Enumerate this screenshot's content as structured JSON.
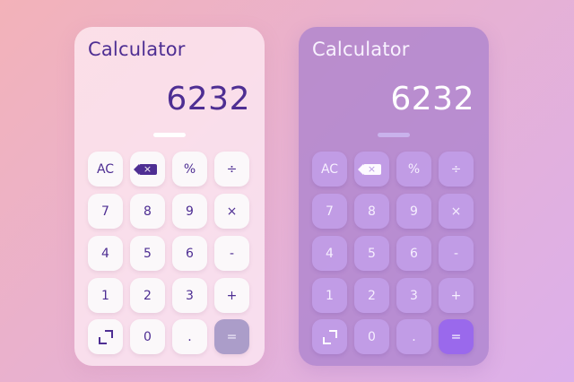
{
  "light": {
    "title": "Calculator",
    "display": "6232",
    "keys": {
      "ac": "AC",
      "percent": "%",
      "divide": "÷",
      "seven": "7",
      "eight": "8",
      "nine": "9",
      "multiply": "×",
      "four": "4",
      "five": "5",
      "six": "6",
      "minus": "-",
      "one": "1",
      "two": "2",
      "three": "3",
      "plus": "+",
      "zero": "0",
      "dot": ".",
      "equals": "="
    },
    "icons": {
      "backspace": "backspace-icon",
      "expand": "expand-icon"
    },
    "colors": {
      "text": "#4e2e93",
      "key": "#fbf8fa",
      "equals": "#ab9dc9"
    }
  },
  "dark": {
    "title": "Calculator",
    "display": "6232",
    "keys": {
      "ac": "AC",
      "percent": "%",
      "divide": "÷",
      "seven": "7",
      "eight": "8",
      "nine": "9",
      "multiply": "×",
      "four": "4",
      "five": "5",
      "six": "6",
      "minus": "-",
      "one": "1",
      "two": "2",
      "three": "3",
      "plus": "+",
      "zero": "0",
      "dot": ".",
      "equals": "="
    },
    "icons": {
      "backspace": "backspace-icon",
      "expand": "expand-icon"
    },
    "colors": {
      "text": "#ffffff",
      "key": "#c4a2ec",
      "equals": "#9a69ec"
    }
  }
}
